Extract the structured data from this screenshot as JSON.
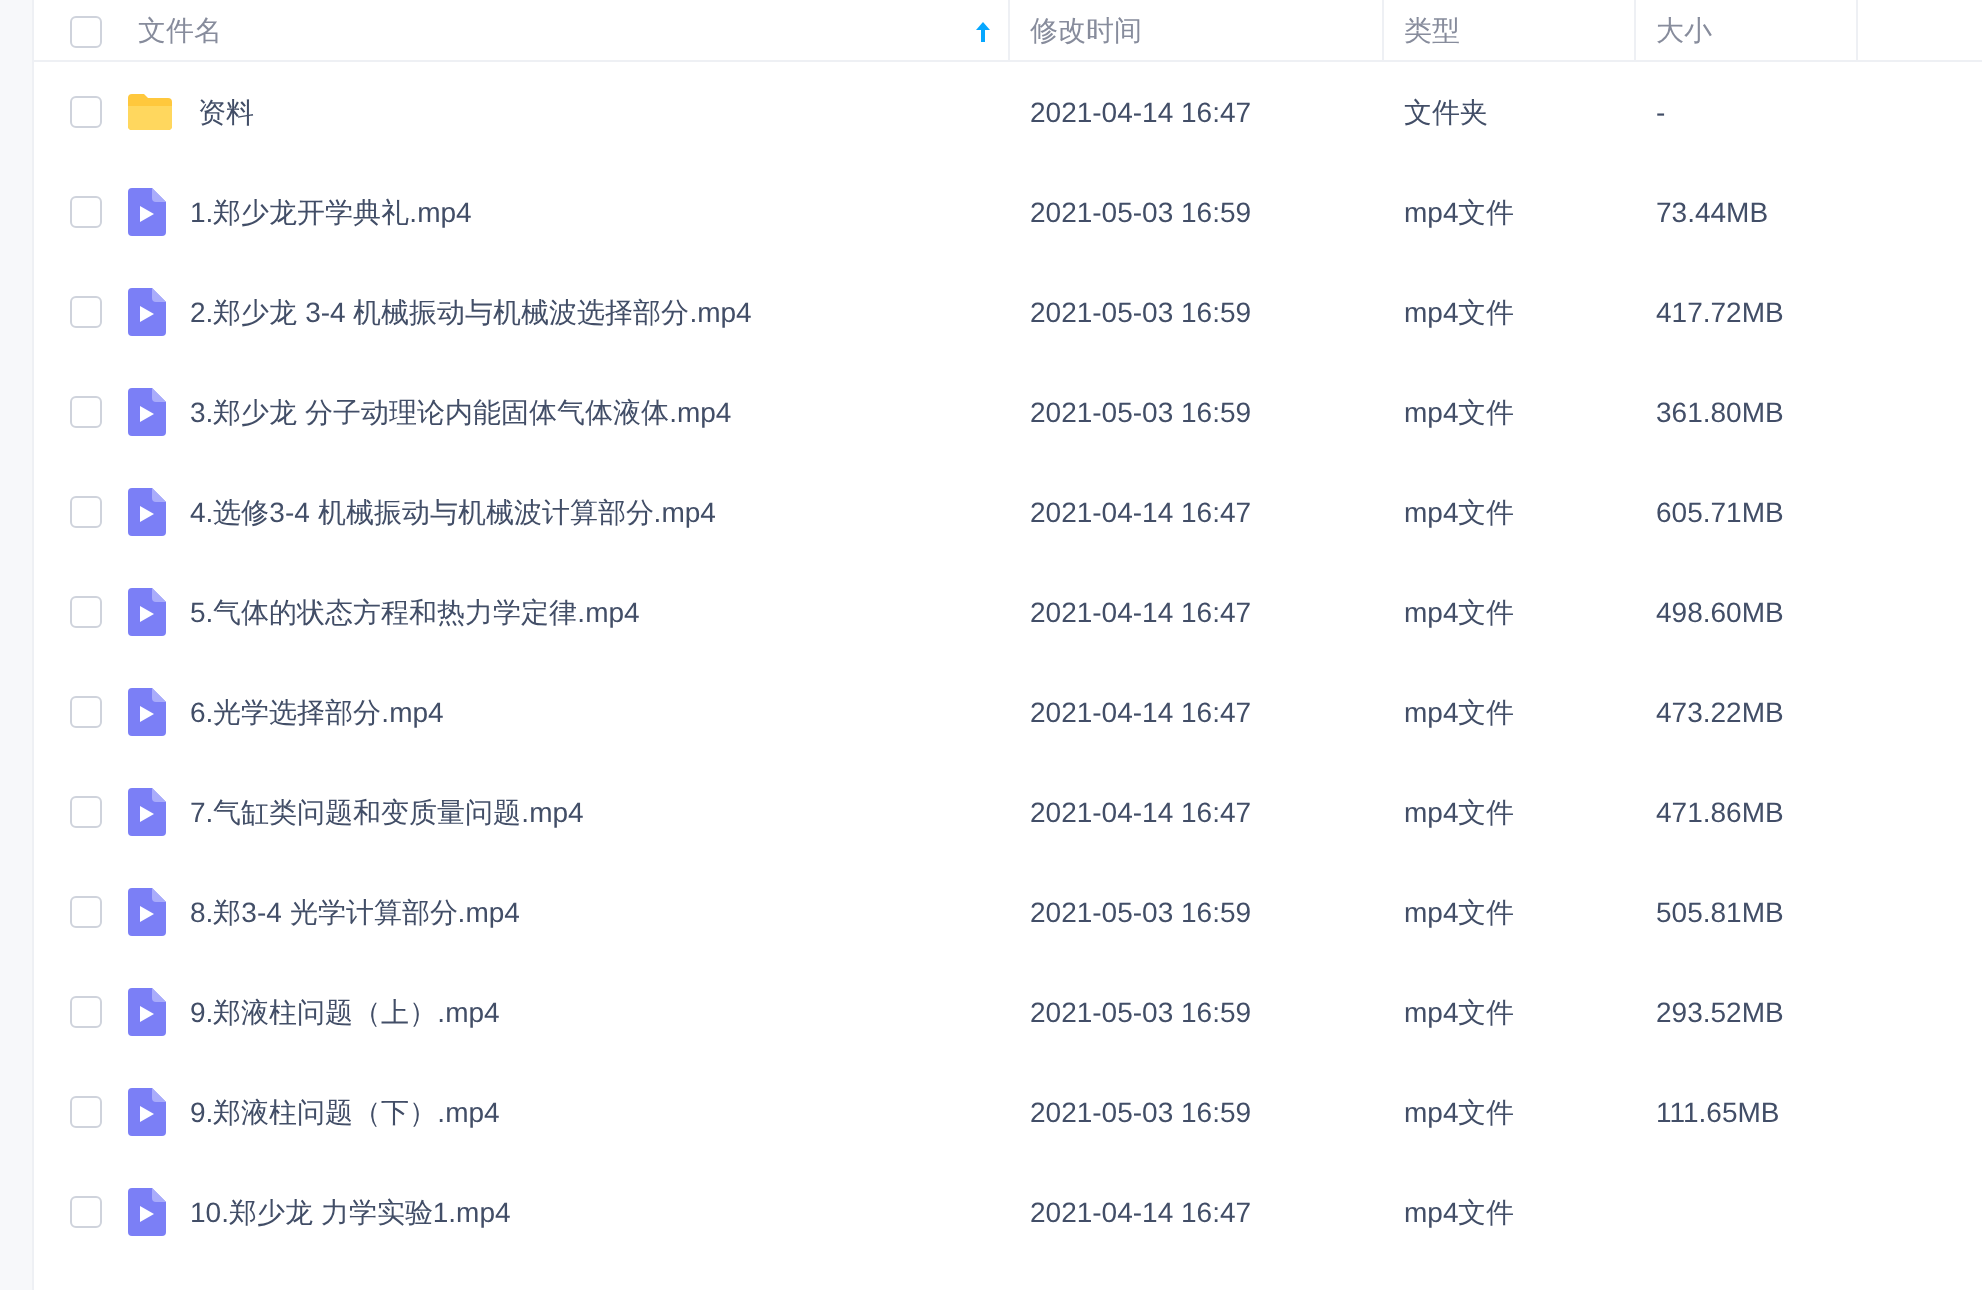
{
  "table": {
    "columns": [
      {
        "label": "文件名",
        "sorted": true
      },
      {
        "label": "修改时间",
        "sorted": false
      },
      {
        "label": "类型",
        "sorted": false
      },
      {
        "label": "大小",
        "sorted": false
      }
    ],
    "header_checked": false,
    "rows": [
      {
        "kind": "folder",
        "checked": false,
        "name": "资料",
        "modified": "2021-04-14 16:47",
        "type": "文件夹",
        "size": "-"
      },
      {
        "kind": "video",
        "checked": false,
        "name": "1.郑少龙开学典礼.mp4",
        "modified": "2021-05-03 16:59",
        "type": "mp4文件",
        "size": "73.44MB"
      },
      {
        "kind": "video",
        "checked": false,
        "name": "2.郑少龙 3-4 机械振动与机械波选择部分.mp4",
        "modified": "2021-05-03 16:59",
        "type": "mp4文件",
        "size": "417.72MB"
      },
      {
        "kind": "video",
        "checked": false,
        "name": "3.郑少龙 分子动理论内能固体气体液体.mp4",
        "modified": "2021-05-03 16:59",
        "type": "mp4文件",
        "size": "361.80MB"
      },
      {
        "kind": "video",
        "checked": false,
        "name": "4.选修3-4 机械振动与机械波计算部分.mp4",
        "modified": "2021-04-14 16:47",
        "type": "mp4文件",
        "size": "605.71MB"
      },
      {
        "kind": "video",
        "checked": false,
        "name": "5.气体的状态方程和热力学定律.mp4",
        "modified": "2021-04-14 16:47",
        "type": "mp4文件",
        "size": "498.60MB"
      },
      {
        "kind": "video",
        "checked": false,
        "name": "6.光学选择部分.mp4",
        "modified": "2021-04-14 16:47",
        "type": "mp4文件",
        "size": "473.22MB"
      },
      {
        "kind": "video",
        "checked": false,
        "name": "7.气缸类问题和变质量问题.mp4",
        "modified": "2021-04-14 16:47",
        "type": "mp4文件",
        "size": "471.86MB"
      },
      {
        "kind": "video",
        "checked": false,
        "name": "8.郑3-4 光学计算部分.mp4",
        "modified": "2021-05-03 16:59",
        "type": "mp4文件",
        "size": "505.81MB"
      },
      {
        "kind": "video",
        "checked": false,
        "name": "9.郑液柱问题（上）.mp4",
        "modified": "2021-05-03 16:59",
        "type": "mp4文件",
        "size": "293.52MB"
      },
      {
        "kind": "video",
        "checked": false,
        "name": "9.郑液柱问题（下）.mp4",
        "modified": "2021-05-03 16:59",
        "type": "mp4文件",
        "size": "111.65MB"
      },
      {
        "kind": "video",
        "checked": false,
        "name": "10.郑少龙 力学实验1.mp4",
        "modified": "2021-04-14 16:47",
        "type": "mp4文件"
      }
    ]
  }
}
